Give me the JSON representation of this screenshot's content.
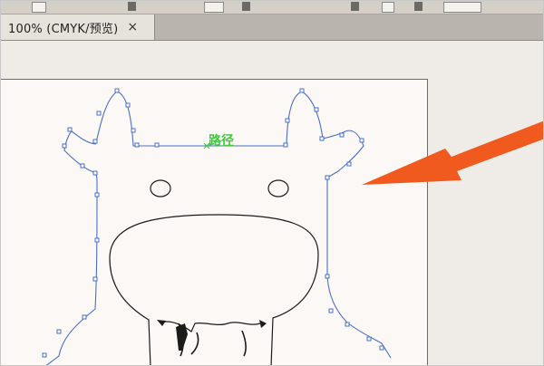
{
  "document_tab": {
    "label": "100% (CMYK/预览)",
    "close_glyph": "×"
  },
  "canvas": {
    "selection_tooltip": "路径",
    "path_color": "#4a6fc7",
    "label_color": "#3dcc3d",
    "arrow_color": "#f05a1e"
  }
}
